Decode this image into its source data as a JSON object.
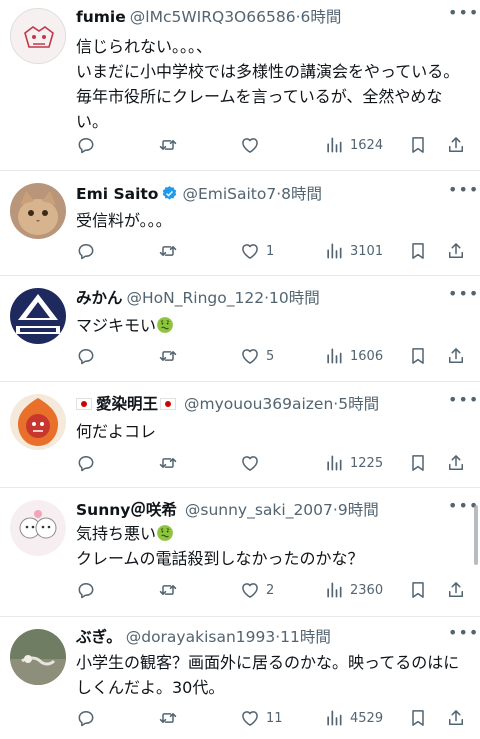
{
  "tweets": [
    {
      "name": "fumie",
      "handle": "@lMc5WIRQ3O66586",
      "time": "6時間",
      "text": "信じられない。。。、\nいまだに小中学校では多様性の講演会をやっている。毎年市役所にクレームを言っているが、全然やめない。",
      "replies": "",
      "retweets": "",
      "likes": "",
      "views": "1624"
    },
    {
      "name": "Emi Saito",
      "verified": true,
      "handle": "@EmiSaito7",
      "time": "8時間",
      "text": "受信料が。。。",
      "replies": "",
      "retweets": "",
      "likes": "1",
      "views": "3101"
    },
    {
      "name": "みかん",
      "handle": "@HoN_Ringo_122",
      "time": "10時間",
      "text": "マジキモい",
      "text_emoji": "nauseated-face",
      "replies": "",
      "retweets": "",
      "likes": "5",
      "views": "1606"
    },
    {
      "name": "愛染明王",
      "name_flags": "japan-flag",
      "handle": "@myouou369aizen",
      "time": "5時間",
      "text": "何だよコレ",
      "replies": "",
      "retweets": "",
      "likes": "",
      "views": "1225"
    },
    {
      "name": "Sunny＠咲希",
      "handle": "@sunny_saki_2007",
      "time": "9時間",
      "text_line1": "気持ち悪い",
      "text_emoji": "nauseated-face",
      "text_line2": "クレームの電話殺到しなかったのかな？",
      "replies": "",
      "retweets": "",
      "likes": "2",
      "views": "2360"
    },
    {
      "name": "ぶぎ。",
      "handle": "@dorayakisan1993",
      "time": "11時間",
      "text": "小学生の観客？画面外に居るのかな。映ってるのはにしくんだよ。30代。",
      "replies": "",
      "retweets": "",
      "likes": "11",
      "views": "4529"
    }
  ],
  "colors": {
    "text": "#0f1419",
    "secondary": "#536471",
    "divider": "#e6e9ec",
    "verified": "#1d9bf0"
  },
  "icons": [
    "reply-icon",
    "retweet-icon",
    "like-icon",
    "views-icon",
    "bookmark-icon",
    "share-icon",
    "more-icon"
  ]
}
